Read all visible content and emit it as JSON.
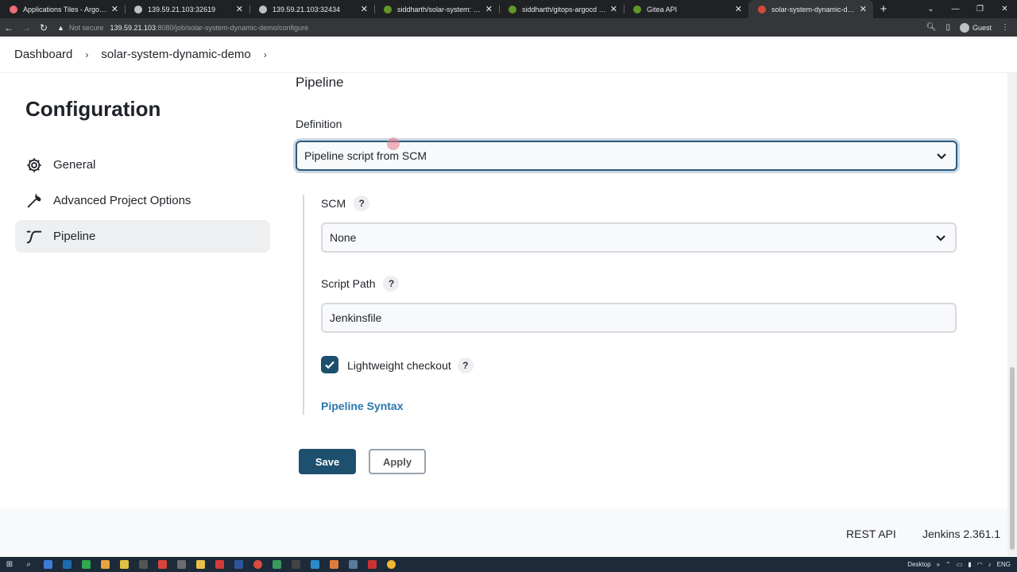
{
  "browser": {
    "tabs": [
      {
        "title": "Applications Tiles - Argo CD",
        "favicon_color": "#e96d76",
        "active": false
      },
      {
        "title": "139.59.21.103:32619",
        "favicon_color": "#bdc1c6",
        "active": false
      },
      {
        "title": "139.59.21.103:32434",
        "favicon_color": "#bdc1c6",
        "active": false
      },
      {
        "title": "siddharth/solar-system: Simple I",
        "favicon_color": "#609926",
        "active": false
      },
      {
        "title": "siddharth/gitops-argocd - gitop",
        "favicon_color": "#609926",
        "active": false
      },
      {
        "title": "Gitea API",
        "favicon_color": "#609926",
        "active": false
      },
      {
        "title": "solar-system-dynamic-demo Co",
        "favicon_color": "#d24939",
        "active": true
      }
    ],
    "new_tab": "+",
    "security_label": "Not secure",
    "url_host": "139.59.21.103",
    "url_path": ":8080/job/solar-system-dynamic-demo/configure",
    "profile": "Guest"
  },
  "breadcrumb": {
    "items": [
      "Dashboard",
      "solar-system-dynamic-demo"
    ],
    "separator": "›"
  },
  "sidebar": {
    "title": "Configuration",
    "items": [
      {
        "label": "General",
        "icon": "gear-icon"
      },
      {
        "label": "Advanced Project Options",
        "icon": "wrench-icon"
      },
      {
        "label": "Pipeline",
        "icon": "pipeline-icon"
      }
    ],
    "active_index": 2
  },
  "main": {
    "section_title": "Pipeline",
    "definition_label": "Definition",
    "definition_value": "Pipeline script from SCM",
    "scm_label": "SCM",
    "scm_value": "None",
    "script_path_label": "Script Path",
    "script_path_value": "Jenkinsfile",
    "lightweight_label": "Lightweight checkout",
    "lightweight_checked": true,
    "help_glyph": "?",
    "pipeline_syntax_link": "Pipeline Syntax",
    "save_label": "Save",
    "apply_label": "Apply"
  },
  "footer": {
    "rest_api": "REST API",
    "version": "Jenkins 2.361.1"
  },
  "taskbar": {
    "desktop_label": "Desktop",
    "lang": "ENG"
  },
  "colors": {
    "accent": "#1d4f6e",
    "link": "#2b78ad"
  }
}
